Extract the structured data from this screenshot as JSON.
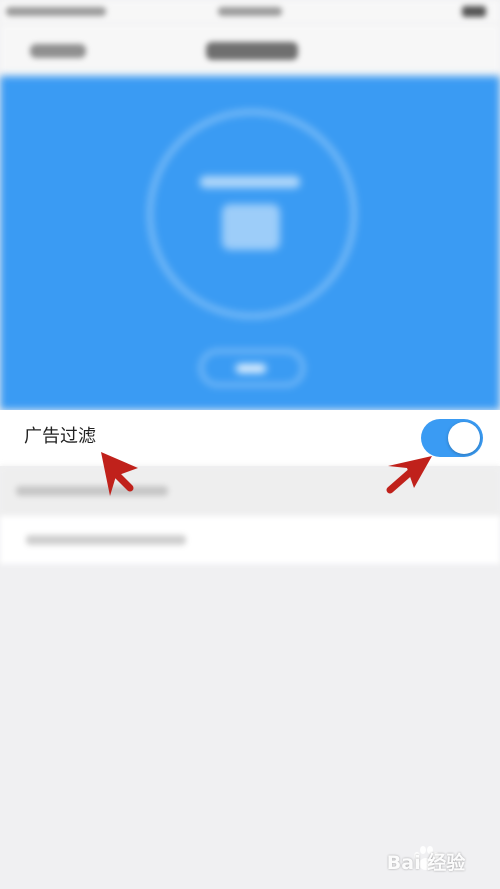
{
  "setting": {
    "label": "广告过滤",
    "toggle_on": true
  },
  "colors": {
    "accent": "#3a9bf3",
    "annotation": "#c0211b",
    "background": "#f0f0f2"
  },
  "watermark": {
    "text": "Bai 经验"
  }
}
